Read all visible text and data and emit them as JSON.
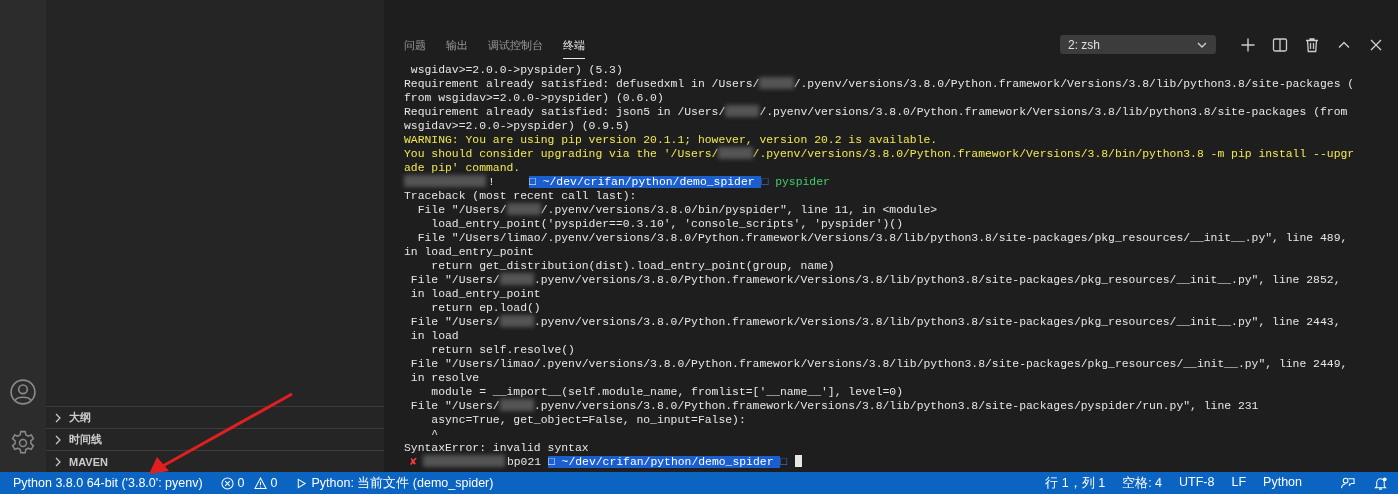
{
  "sidebar": {
    "sections": [
      {
        "label": "大纲",
        "expanded": false
      },
      {
        "label": "时间线",
        "expanded": false
      },
      {
        "label": "MAVEN",
        "expanded": false
      }
    ]
  },
  "panel": {
    "tabs": [
      {
        "label": "问题",
        "selected": false
      },
      {
        "label": "输出",
        "selected": false
      },
      {
        "label": "调试控制台",
        "selected": false
      },
      {
        "label": "终端",
        "selected": true
      }
    ],
    "terminal_selector": {
      "value": "2: zsh"
    },
    "terminal_lines": [
      [
        {
          "kind": "plain",
          "text": " wsgidav>=2.0.0->pyspider) (5.3)"
        }
      ],
      [
        {
          "kind": "plain",
          "text": "Requirement already satisfied: defusedxml in /Users/"
        },
        {
          "kind": "redacted-name"
        },
        {
          "kind": "plain",
          "text": "/.pyenv/versions/3.8.0/Python.framework/Versions/3.8/lib/python3.8/site-packages ("
        }
      ],
      [
        {
          "kind": "plain",
          "text": "from wsgidav>=2.0.0->pyspider) (0.6.0)"
        }
      ],
      [
        {
          "kind": "plain",
          "text": "Requirement already satisfied: json5 in /Users/"
        },
        {
          "kind": "redacted-name"
        },
        {
          "kind": "plain",
          "text": "/.pyenv/versions/3.8.0/Python.framework/Versions/3.8/lib/python3.8/site-packages (from"
        }
      ],
      [
        {
          "kind": "plain",
          "text": "wsgidav>=2.0.0->pyspider) (0.9.5)"
        }
      ],
      [
        {
          "kind": "warning",
          "text": "WARNING: You are using pip version 20.1.1; however, version 20.2 is available."
        }
      ],
      [
        {
          "kind": "warning",
          "text": "You should consider upgrading via the '/Users/"
        },
        {
          "kind": "redacted-name"
        },
        {
          "kind": "warning",
          "text": "/.pyenv/versions/3.8.0/Python.framework/Versions/3.8/bin/python3.8 -m pip install --upgr"
        }
      ],
      [
        {
          "kind": "warning",
          "text": "ade pip' command."
        }
      ],
      [
        {
          "kind": "redacted-host"
        },
        {
          "kind": "plain",
          "text": "!     "
        },
        {
          "kind": "path",
          "text": "□ ~/dev/crifan/python/demo_spider "
        },
        {
          "kind": "path-end",
          "text": "□"
        },
        {
          "kind": "command",
          "text": " pyspider"
        }
      ],
      [
        {
          "kind": "plain",
          "text": "Traceback (most recent call last):"
        }
      ],
      [
        {
          "kind": "plain",
          "text": "  File \"/Users/"
        },
        {
          "kind": "redacted-name"
        },
        {
          "kind": "plain",
          "text": "/.pyenv/versions/3.8.0/bin/pyspider\", line 11, in <module>"
        }
      ],
      [
        {
          "kind": "plain",
          "text": "    load_entry_point('pyspider==0.3.10', 'console_scripts', 'pyspider')()"
        }
      ],
      [
        {
          "kind": "plain",
          "text": "  File \"/Users/limao/.pyenv/versions/3.8.0/Python.framework/Versions/3.8/lib/python3.8/site-packages/pkg_resources/__init__.py\", line 489,"
        }
      ],
      [
        {
          "kind": "plain",
          "text": "in load_entry_point"
        }
      ],
      [
        {
          "kind": "plain",
          "text": "    return get_distribution(dist).load_entry_point(group, name)"
        }
      ],
      [
        {
          "kind": "plain",
          "text": " File \"/Users/"
        },
        {
          "kind": "redacted-name"
        },
        {
          "kind": "plain",
          "text": ".pyenv/versions/3.8.0/Python.framework/Versions/3.8/lib/python3.8/site-packages/pkg_resources/__init__.py\", line 2852,"
        }
      ],
      [
        {
          "kind": "plain",
          "text": " in load_entry_point"
        }
      ],
      [
        {
          "kind": "plain",
          "text": "    return ep.load()"
        }
      ],
      [
        {
          "kind": "plain",
          "text": " File \"/Users/"
        },
        {
          "kind": "redacted-name"
        },
        {
          "kind": "plain",
          "text": ".pyenv/versions/3.8.0/Python.framework/Versions/3.8/lib/python3.8/site-packages/pkg_resources/__init__.py\", line 2443,"
        }
      ],
      [
        {
          "kind": "plain",
          "text": " in load"
        }
      ],
      [
        {
          "kind": "plain",
          "text": "    return self.resolve()"
        }
      ],
      [
        {
          "kind": "plain",
          "text": " File \"/Users/limao/.pyenv/versions/3.8.0/Python.framework/Versions/3.8/lib/python3.8/site-packages/pkg_resources/__init__.py\", line 2449,"
        }
      ],
      [
        {
          "kind": "plain",
          "text": " in resolve"
        }
      ],
      [
        {
          "kind": "plain",
          "text": "    module = __import__(self.module_name, fromlist=['__name__'], level=0)"
        }
      ],
      [
        {
          "kind": "plain",
          "text": " File \"/Users/"
        },
        {
          "kind": "redacted-name"
        },
        {
          "kind": "plain",
          "text": ".pyenv/versions/3.8.0/Python.framework/Versions/3.8/lib/python3.8/site-packages/pyspider/run.py\", line 231"
        }
      ],
      [
        {
          "kind": "plain",
          "text": "    async=True, get_object=False, no_input=False):"
        }
      ],
      [
        {
          "kind": "plain",
          "text": "    ^"
        }
      ],
      [
        {
          "kind": "plain",
          "text": "SyntaxError: invalid syntax"
        }
      ],
      [
        {
          "kind": "error-mark",
          "text": "✘"
        },
        {
          "kind": "redacted-host"
        },
        {
          "kind": "plain",
          "text": "bp021 "
        },
        {
          "kind": "path",
          "text": "□ ~/dev/crifan/python/demo_spider "
        },
        {
          "kind": "path-end",
          "text": "□"
        },
        {
          "kind": "cursor"
        }
      ]
    ]
  },
  "status_bar": {
    "interpreter": "Python 3.8.0 64-bit ('3.8.0': pyenv)",
    "errors": "0",
    "warnings": "0",
    "run_target": "Python: 当前文件 (demo_spider)",
    "items": [
      "行 1，列 1",
      "空格: 4",
      "UTF-8",
      "LF",
      "Python"
    ]
  }
}
